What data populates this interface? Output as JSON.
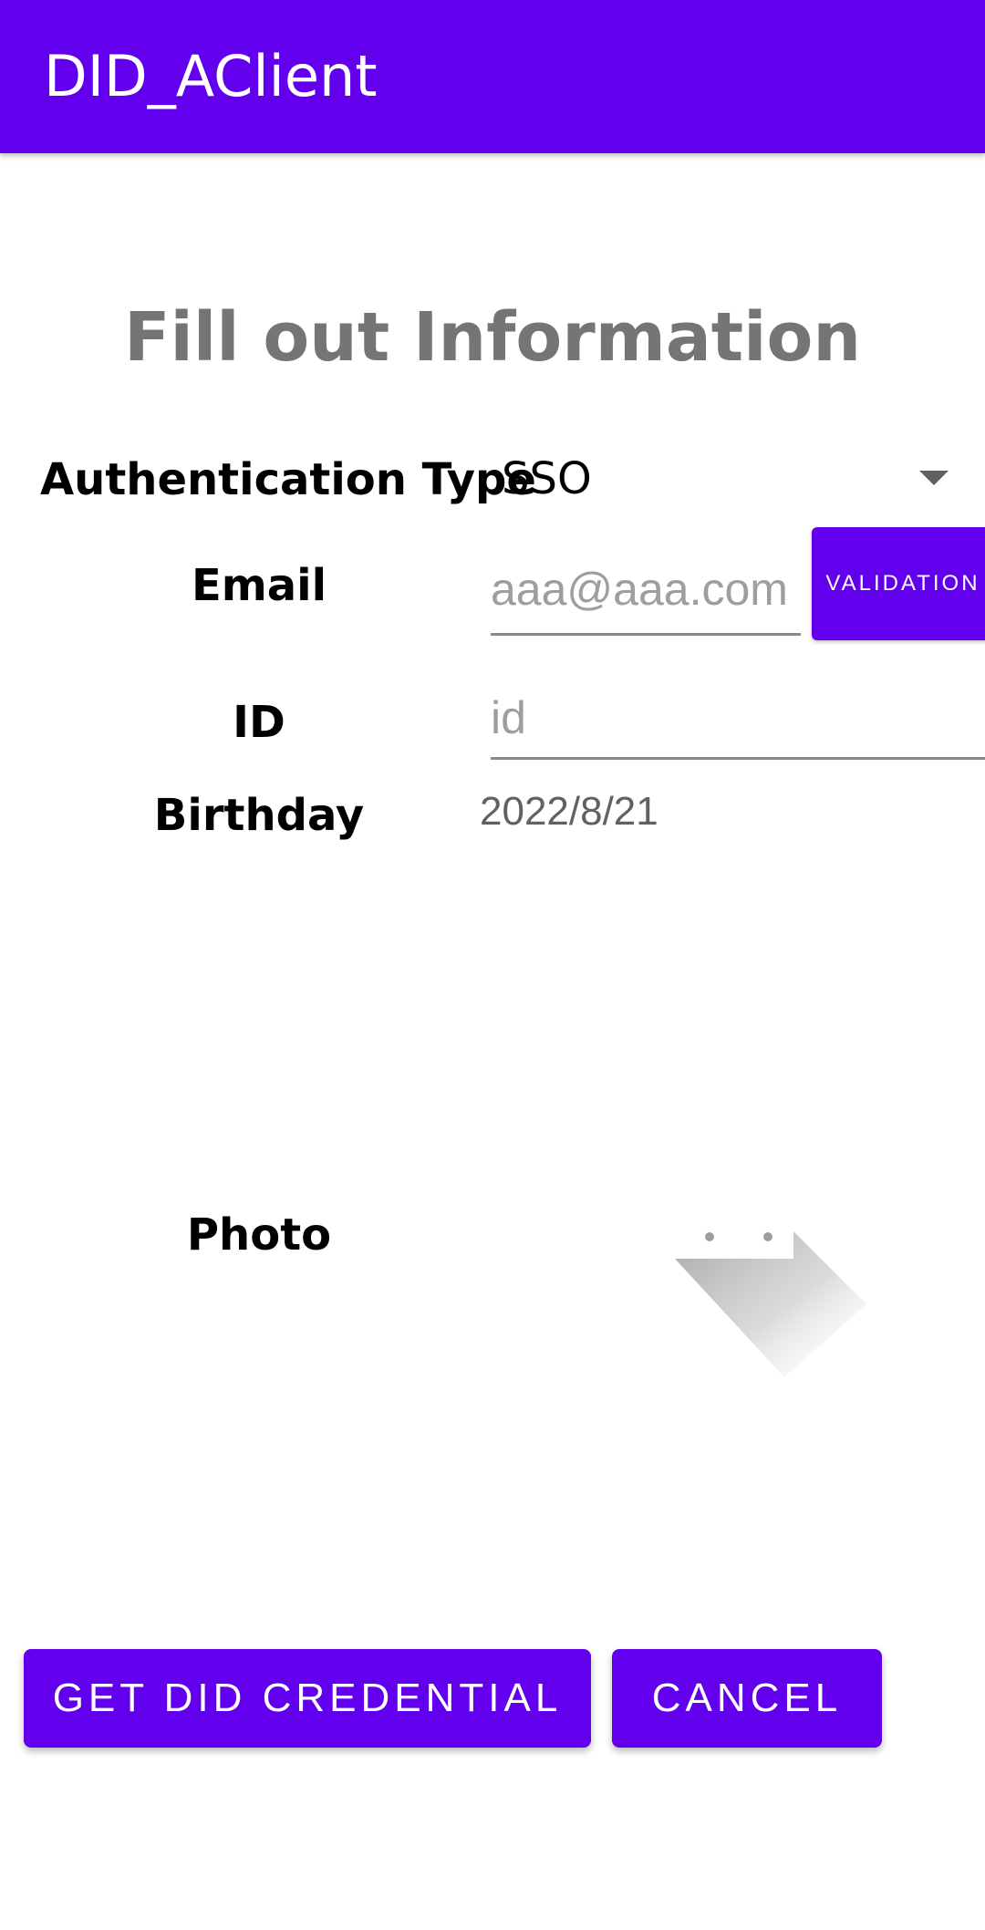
{
  "app_bar": {
    "title": "DID_AClient",
    "color": "#6200EE"
  },
  "form": {
    "heading": "Fill out Information",
    "auth_type": {
      "label": "Authentication Type",
      "selected": "SSO"
    },
    "email": {
      "label": "Email",
      "placeholder": "aaa@aaa.com",
      "value": "",
      "validation_label": "VALIDATION"
    },
    "id": {
      "label": "ID",
      "placeholder": "id",
      "value": ""
    },
    "birthday": {
      "label": "Birthday",
      "value": "2022/8/21"
    },
    "photo": {
      "label": "Photo",
      "icon": "image-placeholder-icon"
    }
  },
  "actions": {
    "get_credential_label": "GET DID CREDENTIAL",
    "cancel_label": "CANCEL"
  }
}
